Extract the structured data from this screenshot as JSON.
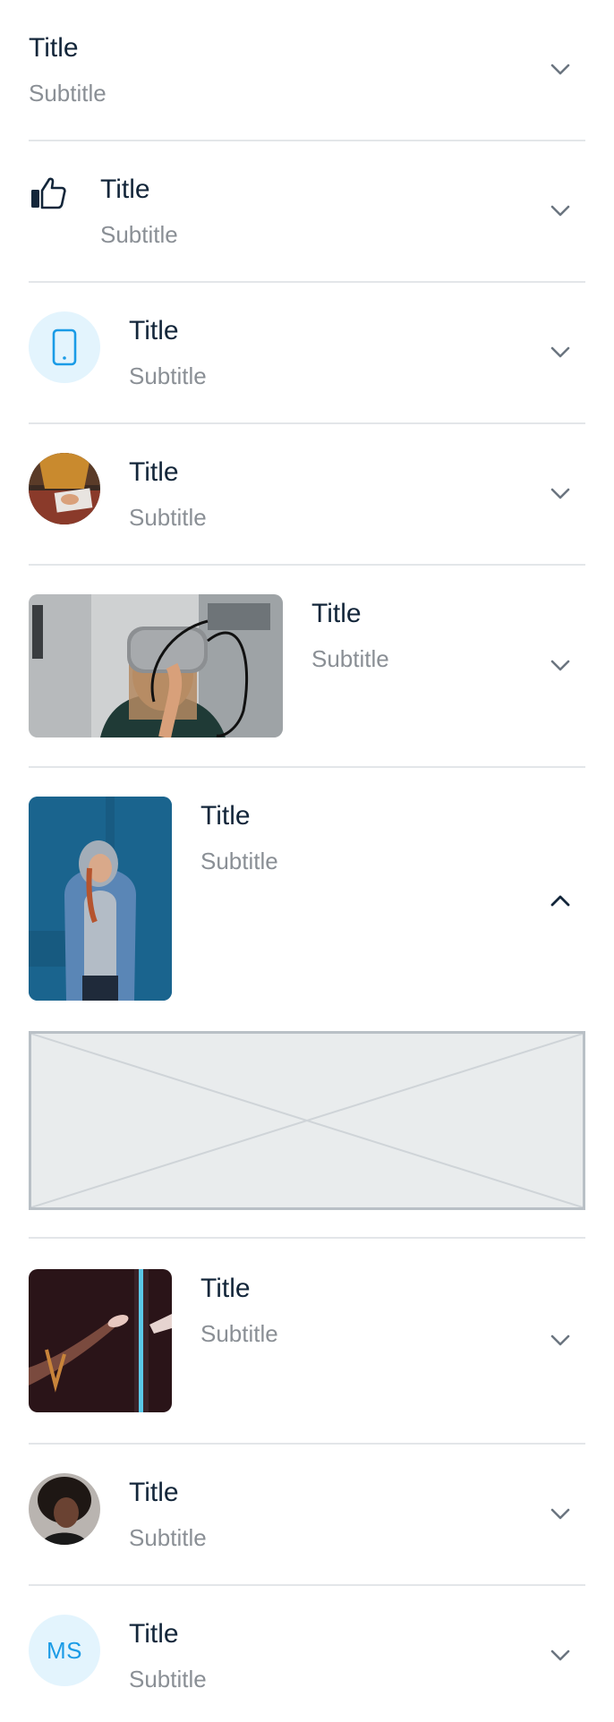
{
  "colors": {
    "title": "#13263a",
    "subtitle": "#8a8f95",
    "divider": "#e3e6e9",
    "chevron": "#6b7580",
    "chevron_expanded": "#13263a",
    "accent": "#1a9be6",
    "accent_bg": "#e3f4fd",
    "placeholder_bg": "#e9eced",
    "placeholder_border": "#b9c0c6"
  },
  "items": [
    {
      "title": "Title",
      "subtitle": "Subtitle",
      "leading": "none",
      "state": "collapsed"
    },
    {
      "title": "Title",
      "subtitle": "Subtitle",
      "leading": "thumbs-up-icon",
      "state": "collapsed"
    },
    {
      "title": "Title",
      "subtitle": "Subtitle",
      "leading": "smartphone-icon",
      "state": "collapsed"
    },
    {
      "title": "Title",
      "subtitle": "Subtitle",
      "leading": "avatar-photo-laptop",
      "state": "collapsed"
    },
    {
      "title": "Title",
      "subtitle": "Subtitle",
      "leading": "photo-vr-headset",
      "state": "collapsed"
    },
    {
      "title": "Title",
      "subtitle": "Subtitle",
      "leading": "photo-hoodie-person",
      "state": "expanded"
    },
    {
      "title": "Title",
      "subtitle": "Subtitle",
      "leading": "photo-hands-neon",
      "state": "collapsed"
    },
    {
      "title": "Title",
      "subtitle": "Subtitle",
      "leading": "avatar-photo-person",
      "state": "collapsed"
    },
    {
      "title": "Title",
      "subtitle": "Subtitle",
      "leading": "initials-avatar",
      "initials": "MS",
      "state": "collapsed"
    }
  ],
  "icons": {
    "collapsed": "chevron-down-icon",
    "expanded": "chevron-up-icon",
    "placeholder": "image-placeholder"
  }
}
